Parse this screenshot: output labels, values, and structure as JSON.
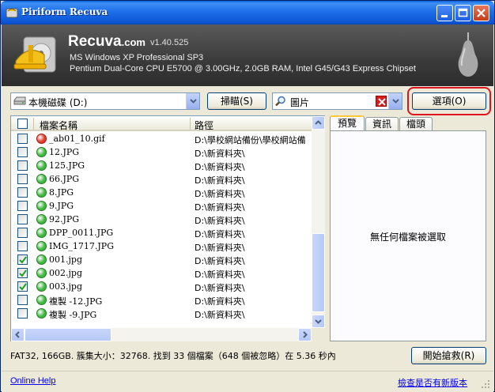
{
  "window": {
    "title": "Piriform Recuva"
  },
  "header": {
    "app_name": "Recuva",
    "app_suffix": ".com",
    "version": "v1.40.525",
    "os": "MS Windows XP Professional SP3",
    "hardware": "Pentium Dual-Core CPU E5700 @ 3.00GHz, 2.0GB RAM, Intel G45/G43 Express Chipset"
  },
  "toolbar": {
    "drive_value": "本機磁碟 (D:)",
    "scan_label": "掃瞄(S)",
    "filter_value": "圖片",
    "options_label": "選項(O)"
  },
  "list": {
    "col_name": "檔案名稱",
    "col_path": "路徑",
    "rows": [
      {
        "name": "_ab01_10.gif",
        "path": "D:\\學校網站備份\\學校網站備",
        "state": "red",
        "checked": false
      },
      {
        "name": "12.JPG",
        "path": "D:\\新資料夾\\",
        "state": "green",
        "checked": false
      },
      {
        "name": "125.JPG",
        "path": "D:\\新資料夾\\",
        "state": "green",
        "checked": false
      },
      {
        "name": "66.JPG",
        "path": "D:\\新資料夾\\",
        "state": "green",
        "checked": false
      },
      {
        "name": "8.JPG",
        "path": "D:\\新資料夾\\",
        "state": "green",
        "checked": false
      },
      {
        "name": "9.JPG",
        "path": "D:\\新資料夾\\",
        "state": "green",
        "checked": false
      },
      {
        "name": "92.JPG",
        "path": "D:\\新資料夾\\",
        "state": "green",
        "checked": false
      },
      {
        "name": "DPP_0011.JPG",
        "path": "D:\\新資料夾\\",
        "state": "green",
        "checked": false
      },
      {
        "name": "IMG_1717.JPG",
        "path": "D:\\新資料夾\\",
        "state": "green",
        "checked": false
      },
      {
        "name": "001.jpg",
        "path": "D:\\新資料夾\\",
        "state": "green",
        "checked": true
      },
      {
        "name": "002.jpg",
        "path": "D:\\新資料夾\\",
        "state": "green",
        "checked": true
      },
      {
        "name": "003.jpg",
        "path": "D:\\新資料夾\\",
        "state": "green",
        "checked": true
      },
      {
        "name": "複製 -12.JPG",
        "path": "D:\\新資料夾\\",
        "state": "green",
        "checked": false
      },
      {
        "name": "複製 -9.JPG",
        "path": "D:\\新資料夾\\",
        "state": "green",
        "checked": false
      }
    ]
  },
  "panel": {
    "tabs": [
      "預覽",
      "資訊",
      "檔頭"
    ],
    "message": "無任何檔案被選取"
  },
  "status": {
    "text": "FAT32, 166GB. 簇集大小：32768. 找到 33 個檔案（648 個被忽略）在 5.36 秒內",
    "recover_label": "開始搶救(R)"
  },
  "footer": {
    "help_link": "Online Help",
    "update_link": "檢查是否有新版本"
  },
  "colors": {
    "title_bar": "#1e6fe9",
    "state_green": "#3fb83f",
    "state_red": "#e03a2a",
    "highlight": "#e0141e",
    "link": "#0000ee"
  }
}
